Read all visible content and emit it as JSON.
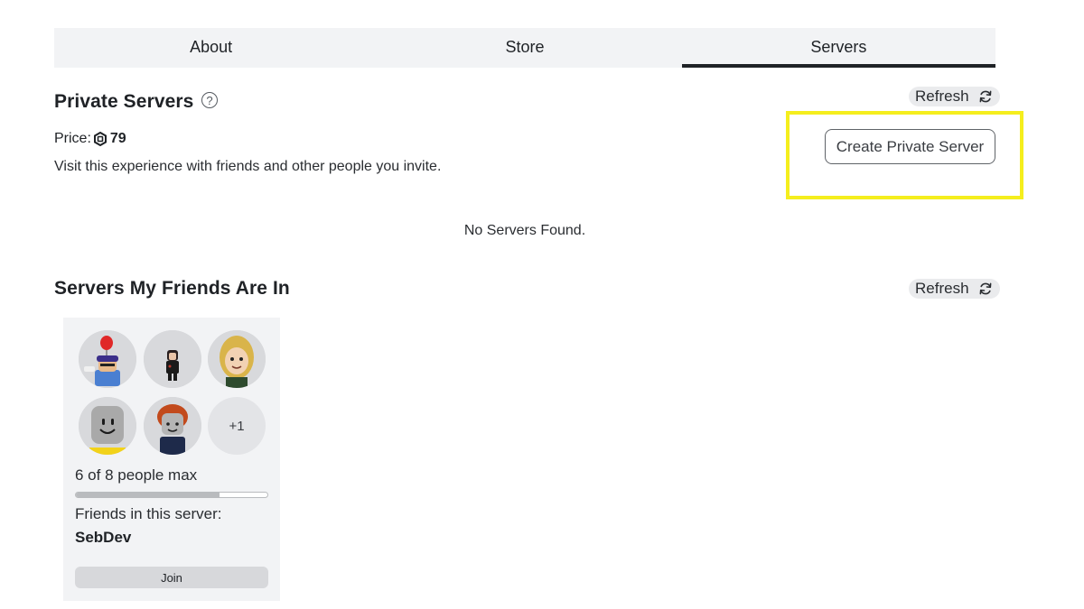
{
  "tabs": [
    {
      "label": "About",
      "active": false
    },
    {
      "label": "Store",
      "active": false
    },
    {
      "label": "Servers",
      "active": true
    }
  ],
  "private_servers": {
    "title": "Private Servers",
    "help_icon": "question-circle-icon",
    "refresh_label": "Refresh",
    "price_label": "Price:",
    "price_currency_icon": "robux-icon",
    "price_value": "79",
    "description": "Visit this experience with friends and other people you invite.",
    "create_button": "Create Private Server",
    "empty_message": "No Servers Found."
  },
  "friends_servers": {
    "title": "Servers My Friends Are In",
    "refresh_label": "Refresh",
    "card": {
      "avatars": [
        "friend-avatar",
        "friend-avatar",
        "friend-avatar",
        "friend-avatar",
        "friend-avatar"
      ],
      "overflow_count": "+1",
      "players_text": "6 of 8 people max",
      "capacity_fraction": 0.75,
      "friends_label": "Friends in this server:",
      "friend_name": "SebDev",
      "join_label": "Join"
    }
  },
  "colors": {
    "highlight": "#f5ee1d",
    "tab_background": "#f2f3f5",
    "active_tab_indicator": "#1f2226"
  }
}
